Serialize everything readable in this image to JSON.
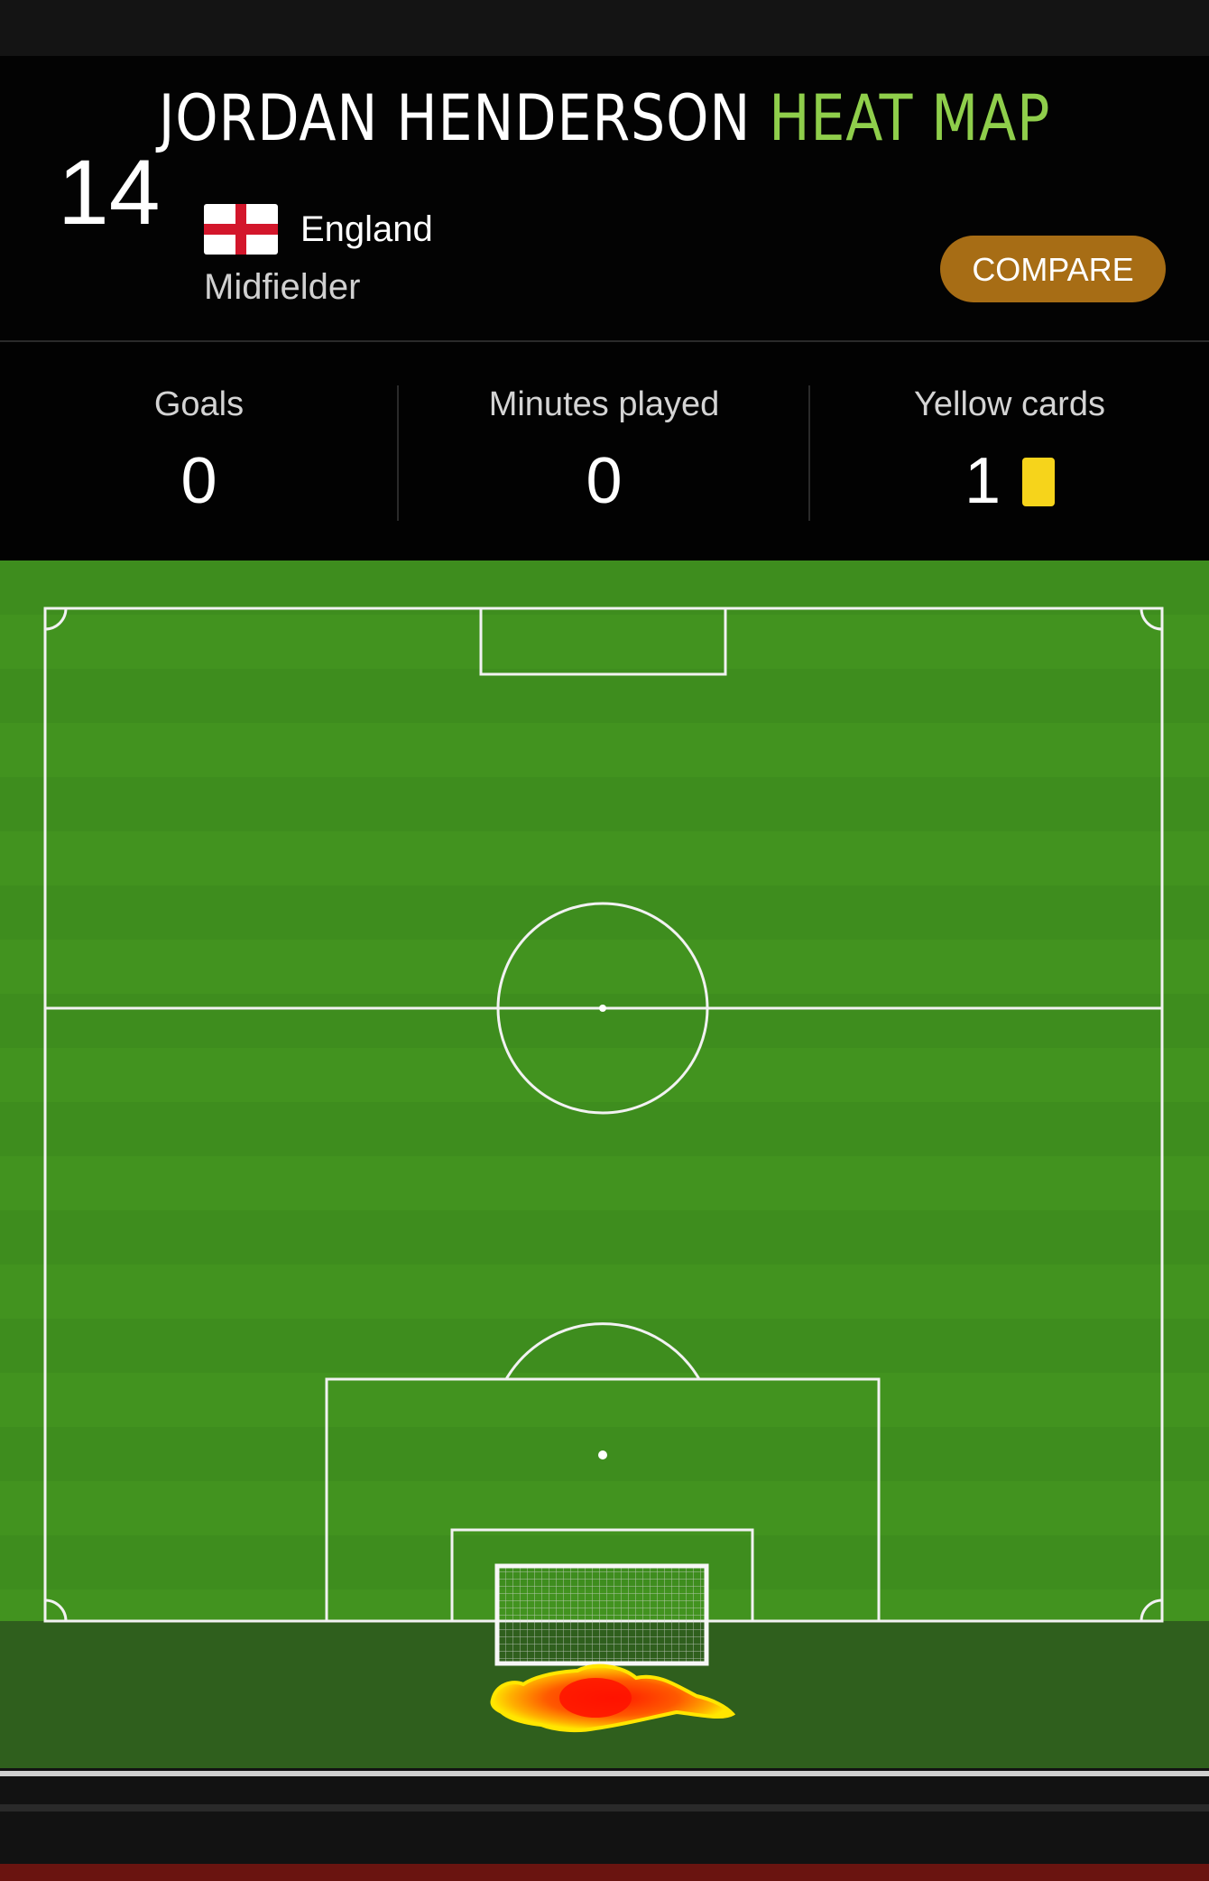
{
  "header": {
    "title_name": "JORDAN HENDERSON",
    "title_accent": "HEAT MAP",
    "jersey_number": "14",
    "country": "England",
    "position": "Midfielder",
    "compare_label": "COMPARE"
  },
  "stats": [
    {
      "label": "Goals",
      "value": "0"
    },
    {
      "label": "Minutes played",
      "value": "0"
    },
    {
      "label": "Yellow cards",
      "value": "1"
    }
  ],
  "colors": {
    "accent_green": "#8fce4b",
    "compare_button": "#a76d15",
    "yellow_card": "#f6d41b",
    "pitch_green": "#3f8f1f",
    "heat_red": "#ff2a00"
  },
  "icons": {
    "flag": "england-flag-icon",
    "card": "yellow-card-icon"
  }
}
